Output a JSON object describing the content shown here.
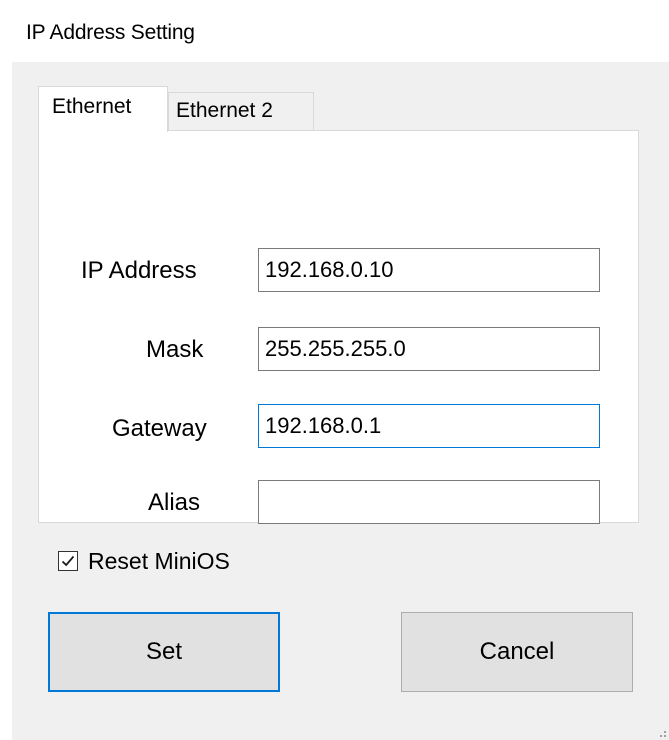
{
  "window": {
    "title": "IP Address Setting"
  },
  "tabs": [
    {
      "label": "Ethernet",
      "active": true
    },
    {
      "label": "Ethernet 2",
      "active": false
    }
  ],
  "fields": {
    "ip_address": {
      "label": "IP Address",
      "value": "192.168.0.10"
    },
    "mask": {
      "label": "Mask",
      "value": "255.255.255.0"
    },
    "gateway": {
      "label": "Gateway",
      "value": "192.168.0.1",
      "focused": true
    },
    "alias": {
      "label": "Alias",
      "value": ""
    }
  },
  "reset_minios": {
    "label": "Reset MiniOS",
    "checked": true
  },
  "buttons": {
    "set_label": "Set",
    "cancel_label": "Cancel"
  },
  "colors": {
    "accent": "#0078d7",
    "window_bg": "#f0f0f0",
    "button_bg": "#e1e1e1"
  },
  "icons": {
    "checkbox": "check-mark-icon",
    "grip": "resize-grip-icon"
  }
}
